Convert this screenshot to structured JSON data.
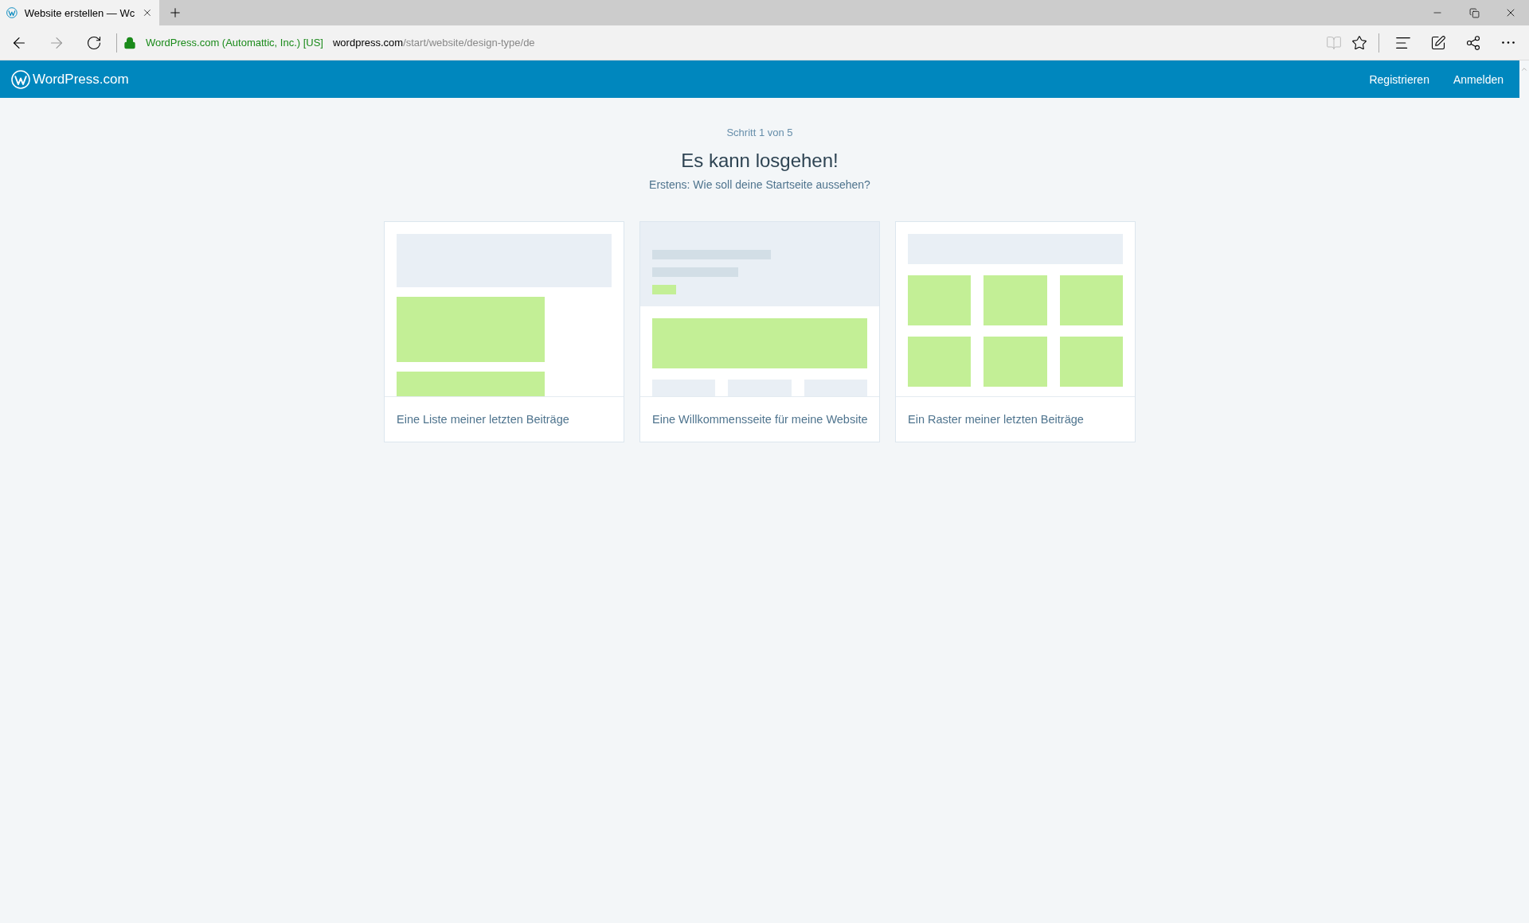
{
  "browser": {
    "tab": {
      "title": "Website erstellen — Wc"
    },
    "address": {
      "identity": "WordPress.com (Automattic, Inc.) [US]",
      "host": "wordpress.com",
      "path": "/start/website/design-type/de"
    }
  },
  "header": {
    "logo": "WordPress.com",
    "nav": [
      {
        "label": "Registrieren"
      },
      {
        "label": "Anmelden"
      }
    ]
  },
  "intro": {
    "step": "Schritt 1 von 5",
    "title": "Es kann losgehen!",
    "subtitle": "Erstens: Wie soll deine Startseite aussehen?"
  },
  "cards": [
    {
      "kind": "list",
      "label": "Eine Liste meiner letzten Beiträge"
    },
    {
      "kind": "welcome",
      "label": "Eine Willkommensseite für meine Website"
    },
    {
      "kind": "grid",
      "label": "Ein Raster meiner letzten Beiträge"
    }
  ]
}
